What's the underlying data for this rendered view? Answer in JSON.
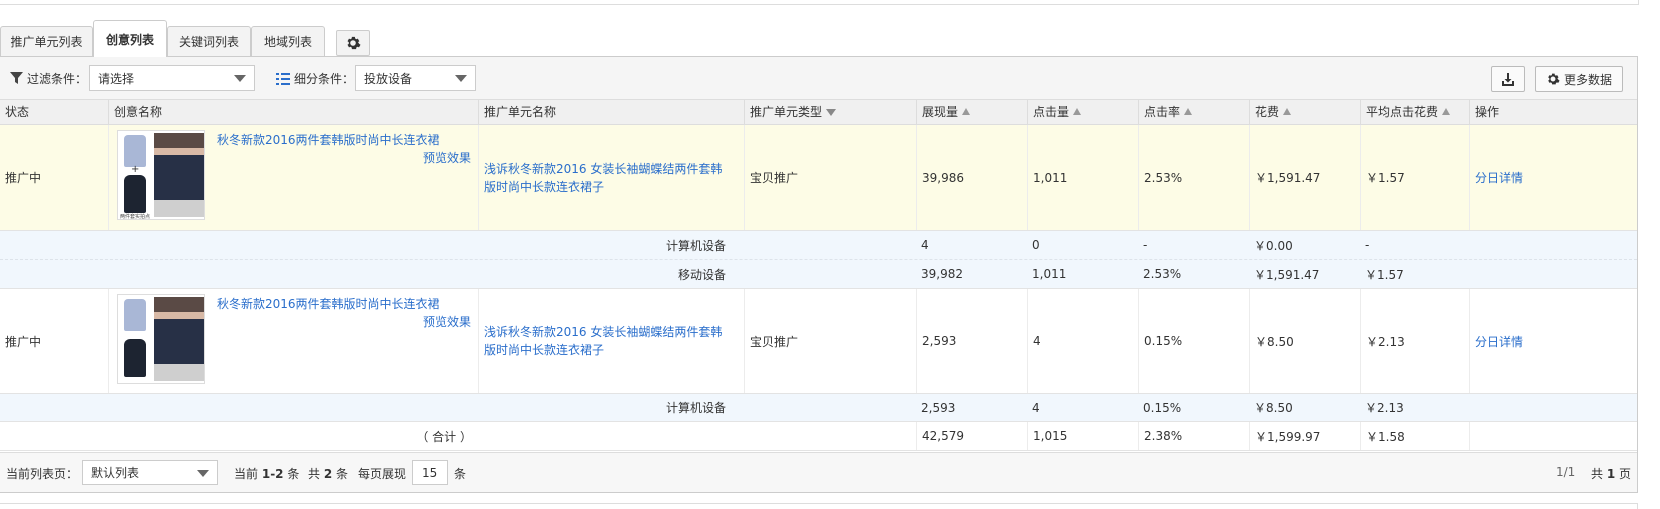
{
  "tabs": [
    "推广单元列表",
    "创意列表",
    "关键词列表",
    "地域列表"
  ],
  "active_tab_index": 1,
  "toolbar": {
    "filter_label": "过滤条件：",
    "filter_value": "请选择",
    "segment_label": "细分条件：",
    "segment_value": "投放设备",
    "more_data_label": "更多数据"
  },
  "columns": [
    "状态",
    "创意名称",
    "推广单元名称",
    "推广单元类型",
    "展现量",
    "点击量",
    "点击率",
    "花费",
    "平均点击花费",
    "操作"
  ],
  "rows": [
    {
      "status": "推广中",
      "creative_name": "秋冬新款2016两件套韩版时尚中长连衣裙",
      "preview": "预览效果",
      "unit_name": "浅诉秋冬新款2016 女装长袖蝴蝶结两件套韩版时尚中长款连衣裙子",
      "unit_type": "宝贝推广",
      "impressions": "39,986",
      "clicks": "1,011",
      "ctr": "2.53%",
      "cost": "￥1,591.47",
      "cpc": "￥1.57",
      "action": "分日详情",
      "thumb_caption": "两件套实拍点",
      "devices": [
        {
          "name": "计算机设备",
          "impressions": "4",
          "clicks": "0",
          "ctr": "-",
          "cost": "￥0.00",
          "cpc": "-"
        },
        {
          "name": "移动设备",
          "impressions": "39,982",
          "clicks": "1,011",
          "ctr": "2.53%",
          "cost": "￥1,591.47",
          "cpc": "￥1.57"
        }
      ]
    },
    {
      "status": "推广中",
      "creative_name": "秋冬新款2016两件套韩版时尚中长连衣裙",
      "preview": "预览效果",
      "unit_name": "浅诉秋冬新款2016 女装长袖蝴蝶结两件套韩版时尚中长款连衣裙子",
      "unit_type": "宝贝推广",
      "impressions": "2,593",
      "clicks": "4",
      "ctr": "0.15%",
      "cost": "￥8.50",
      "cpc": "￥2.13",
      "action": "分日详情",
      "devices": [
        {
          "name": "计算机设备",
          "impressions": "2,593",
          "clicks": "4",
          "ctr": "0.15%",
          "cost": "￥8.50",
          "cpc": "￥2.13"
        }
      ]
    }
  ],
  "total": {
    "label": "（ 合计 ）",
    "impressions": "42,579",
    "clicks": "1,015",
    "ctr": "2.38%",
    "cost": "￥1,599.97",
    "cpc": "￥1.58"
  },
  "pager": {
    "current_list_label": "当前列表页：",
    "current_list_value": "默认列表",
    "range_prefix": "当前",
    "range": "1-2",
    "range_unit": "条",
    "total_prefix": "共",
    "total_count": "2",
    "total_unit": "条",
    "per_page_label": "每页展现",
    "per_page_value": "15",
    "per_page_unit": "条",
    "page_pos": "1/1",
    "pages_prefix": "共",
    "pages_count": "1",
    "pages_unit": "页"
  },
  "colors": {
    "link": "#2a6ecb",
    "highlight_row": "#fdfce6",
    "sub_row": "#f1f7fd",
    "header_bg": "#f0f0f0"
  }
}
